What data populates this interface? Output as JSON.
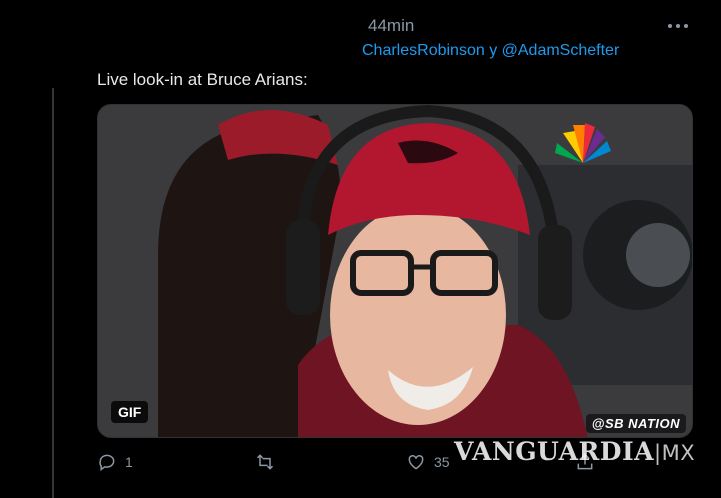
{
  "tweet": {
    "timestamp": "44min",
    "reply_to_1": "CharlesRobinson",
    "reply_sep": "y",
    "reply_to_2": "@AdamSchefter",
    "text": "Live look-in at Bruce Arians:"
  },
  "media": {
    "badge": "GIF",
    "source_bug": "@SB NATION"
  },
  "actions": {
    "reply_count": "1",
    "retweet_count": "",
    "like_count": "35"
  },
  "watermark": {
    "brand": "VANGUARDIA",
    "suffix": "|MX"
  },
  "colors": {
    "background": "#000000",
    "link": "#1d9bf0",
    "muted": "#8b98a5"
  }
}
